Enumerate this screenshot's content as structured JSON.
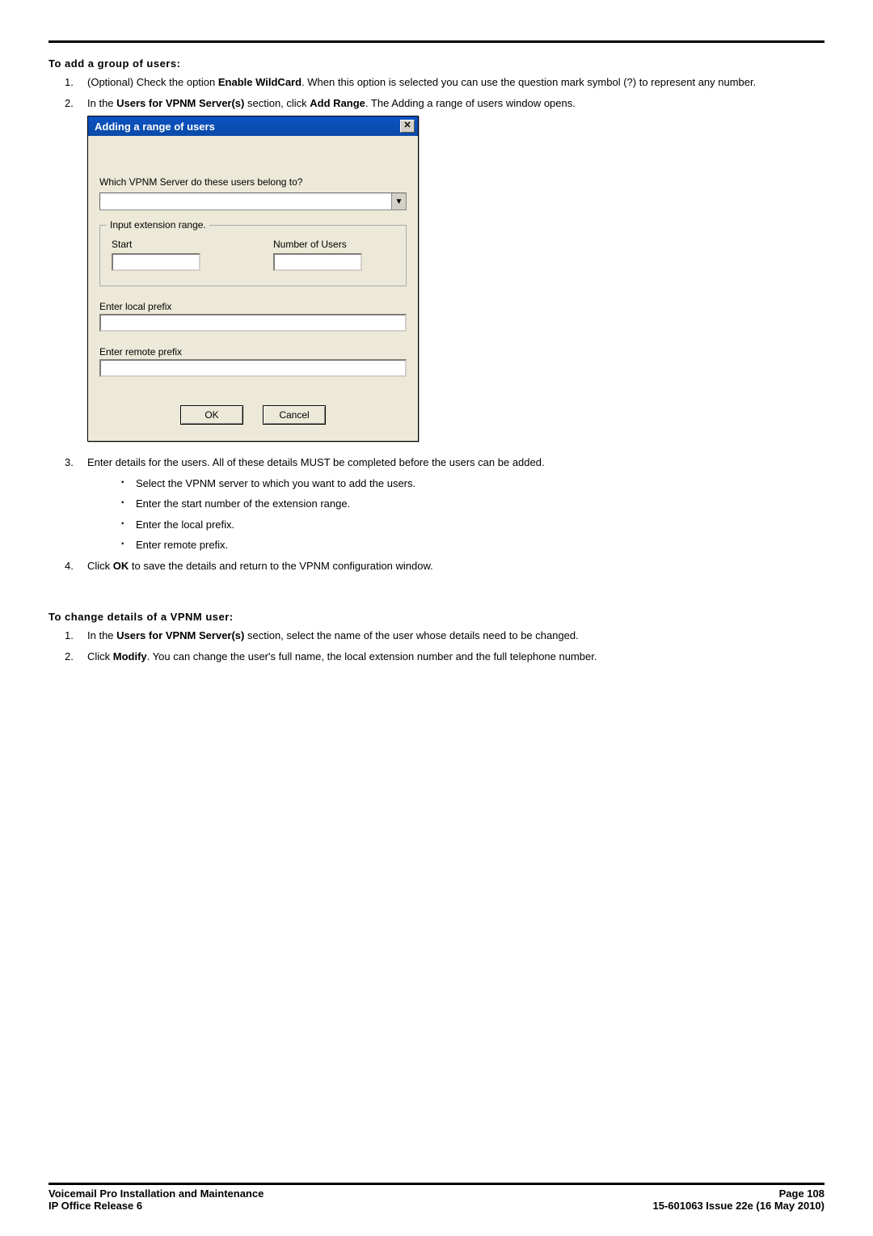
{
  "section1": {
    "title": "To add a group of users:",
    "step1_pre": "(Optional) Check the option ",
    "step1_bold": "Enable WildCard",
    "step1_post": ". When this option is selected you can use the question mark symbol (?) to represent any number.",
    "step2_pre": "In the ",
    "step2_bold1": "Users for VPNM Server(s)",
    "step2_mid": " section, click ",
    "step2_bold2": "Add Range",
    "step2_post": ". The Adding a range of users window opens."
  },
  "dialog": {
    "title": "Adding a range of users",
    "close": "✕",
    "prompt": "Which VPNM Server do these users belong to?",
    "server_value": "",
    "fieldset_legend": "Input extension range.",
    "start_label": "Start",
    "num_users_label": "Number of Users",
    "start_value": "",
    "num_users_value": "",
    "local_prefix_label": "Enter local prefix",
    "local_prefix_value": "",
    "remote_prefix_label": "Enter remote prefix",
    "remote_prefix_value": "",
    "ok": "OK",
    "cancel": "Cancel",
    "dd_arrow": "▼"
  },
  "step3": {
    "text": "Enter details for the users. All of these details MUST be completed before the users can be added.",
    "b1": "Select the VPNM server to which you want to add the users.",
    "b2": "Enter the start number of the extension range.",
    "b3": "Enter the local prefix.",
    "b4": "Enter remote prefix."
  },
  "step4_pre": "Click ",
  "step4_bold": "OK",
  "step4_post": " to save the details and return to the VPNM configuration window.",
  "section2": {
    "title": "To change details of a VPNM user:",
    "step1_pre": "In the ",
    "step1_bold": "Users for VPNM Server(s)",
    "step1_post": " section, select the name of the user whose details need to be changed.",
    "step2_pre": "Click ",
    "step2_bold": "Modify",
    "step2_post": ". You can change the user's full name, the local extension number and the full telephone number."
  },
  "footer": {
    "left1": "Voicemail Pro Installation and Maintenance",
    "left2": "IP Office Release 6",
    "right1": "Page 108",
    "right2": "15-601063 Issue 22e (16 May 2010)"
  },
  "nums": {
    "n1": "1.",
    "n2": "2.",
    "n3": "3.",
    "n4": "4."
  }
}
